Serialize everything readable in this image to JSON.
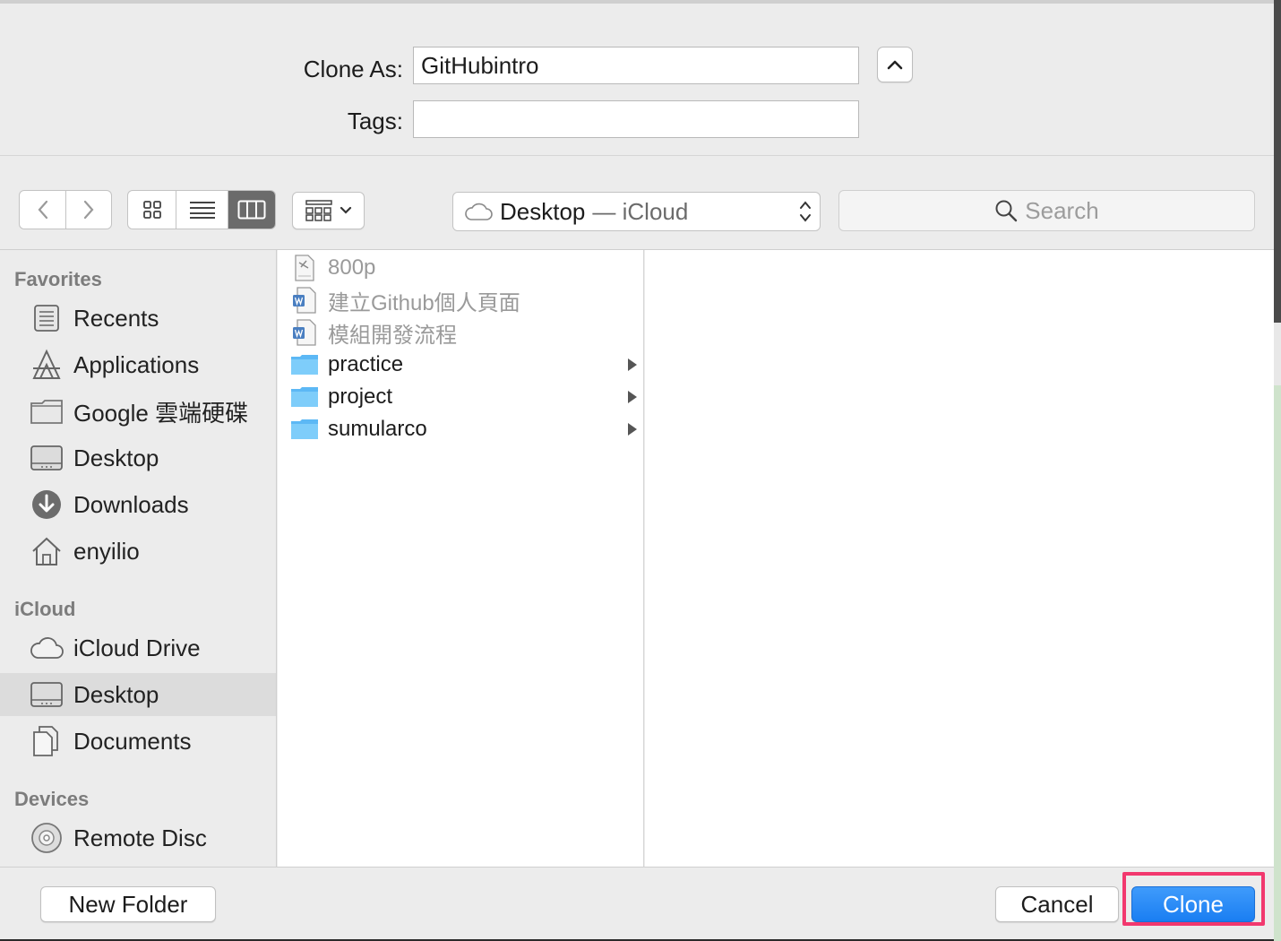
{
  "form": {
    "clone_as_label": "Clone As:",
    "clone_as_value": "GitHubintro",
    "tags_label": "Tags:",
    "tags_value": ""
  },
  "toolbar": {
    "location": "Desktop",
    "location_sub": "— iCloud",
    "search_placeholder": "Search",
    "active_view": "columns"
  },
  "sidebar": {
    "favorites_heading": "Favorites",
    "favorites": [
      {
        "label": "Recents",
        "icon": "recents-icon"
      },
      {
        "label": "Applications",
        "icon": "applications-icon"
      },
      {
        "label": "Google 雲端硬碟",
        "icon": "folder-icon"
      },
      {
        "label": "Desktop",
        "icon": "desktop-icon"
      },
      {
        "label": "Downloads",
        "icon": "downloads-icon"
      },
      {
        "label": "enyilio",
        "icon": "home-icon"
      }
    ],
    "icloud_heading": "iCloud",
    "icloud": [
      {
        "label": "iCloud Drive",
        "icon": "cloud-icon"
      },
      {
        "label": "Desktop",
        "icon": "desktop-icon",
        "selected": true
      },
      {
        "label": "Documents",
        "icon": "documents-icon"
      }
    ],
    "devices_heading": "Devices",
    "devices": [
      {
        "label": "Remote Disc",
        "icon": "disc-icon"
      }
    ]
  },
  "files": [
    {
      "name": "800p",
      "type": "file",
      "dimmed": true,
      "icon": "document-icon"
    },
    {
      "name": "建立Github個人頁面",
      "type": "file",
      "dimmed": true,
      "icon": "word-document-icon"
    },
    {
      "name": "模組開發流程",
      "type": "file",
      "dimmed": true,
      "icon": "word-document-icon"
    },
    {
      "name": "practice",
      "type": "folder",
      "dimmed": false,
      "icon": "folder-icon"
    },
    {
      "name": "project",
      "type": "folder",
      "dimmed": false,
      "icon": "folder-icon"
    },
    {
      "name": "sumularco",
      "type": "folder",
      "dimmed": false,
      "icon": "folder-icon"
    }
  ],
  "buttons": {
    "new_folder": "New Folder",
    "cancel": "Cancel",
    "clone": "Clone"
  },
  "colors": {
    "accent": "#1a7ef2",
    "folder": "#6cc3f7",
    "highlight": "#f2386e"
  }
}
